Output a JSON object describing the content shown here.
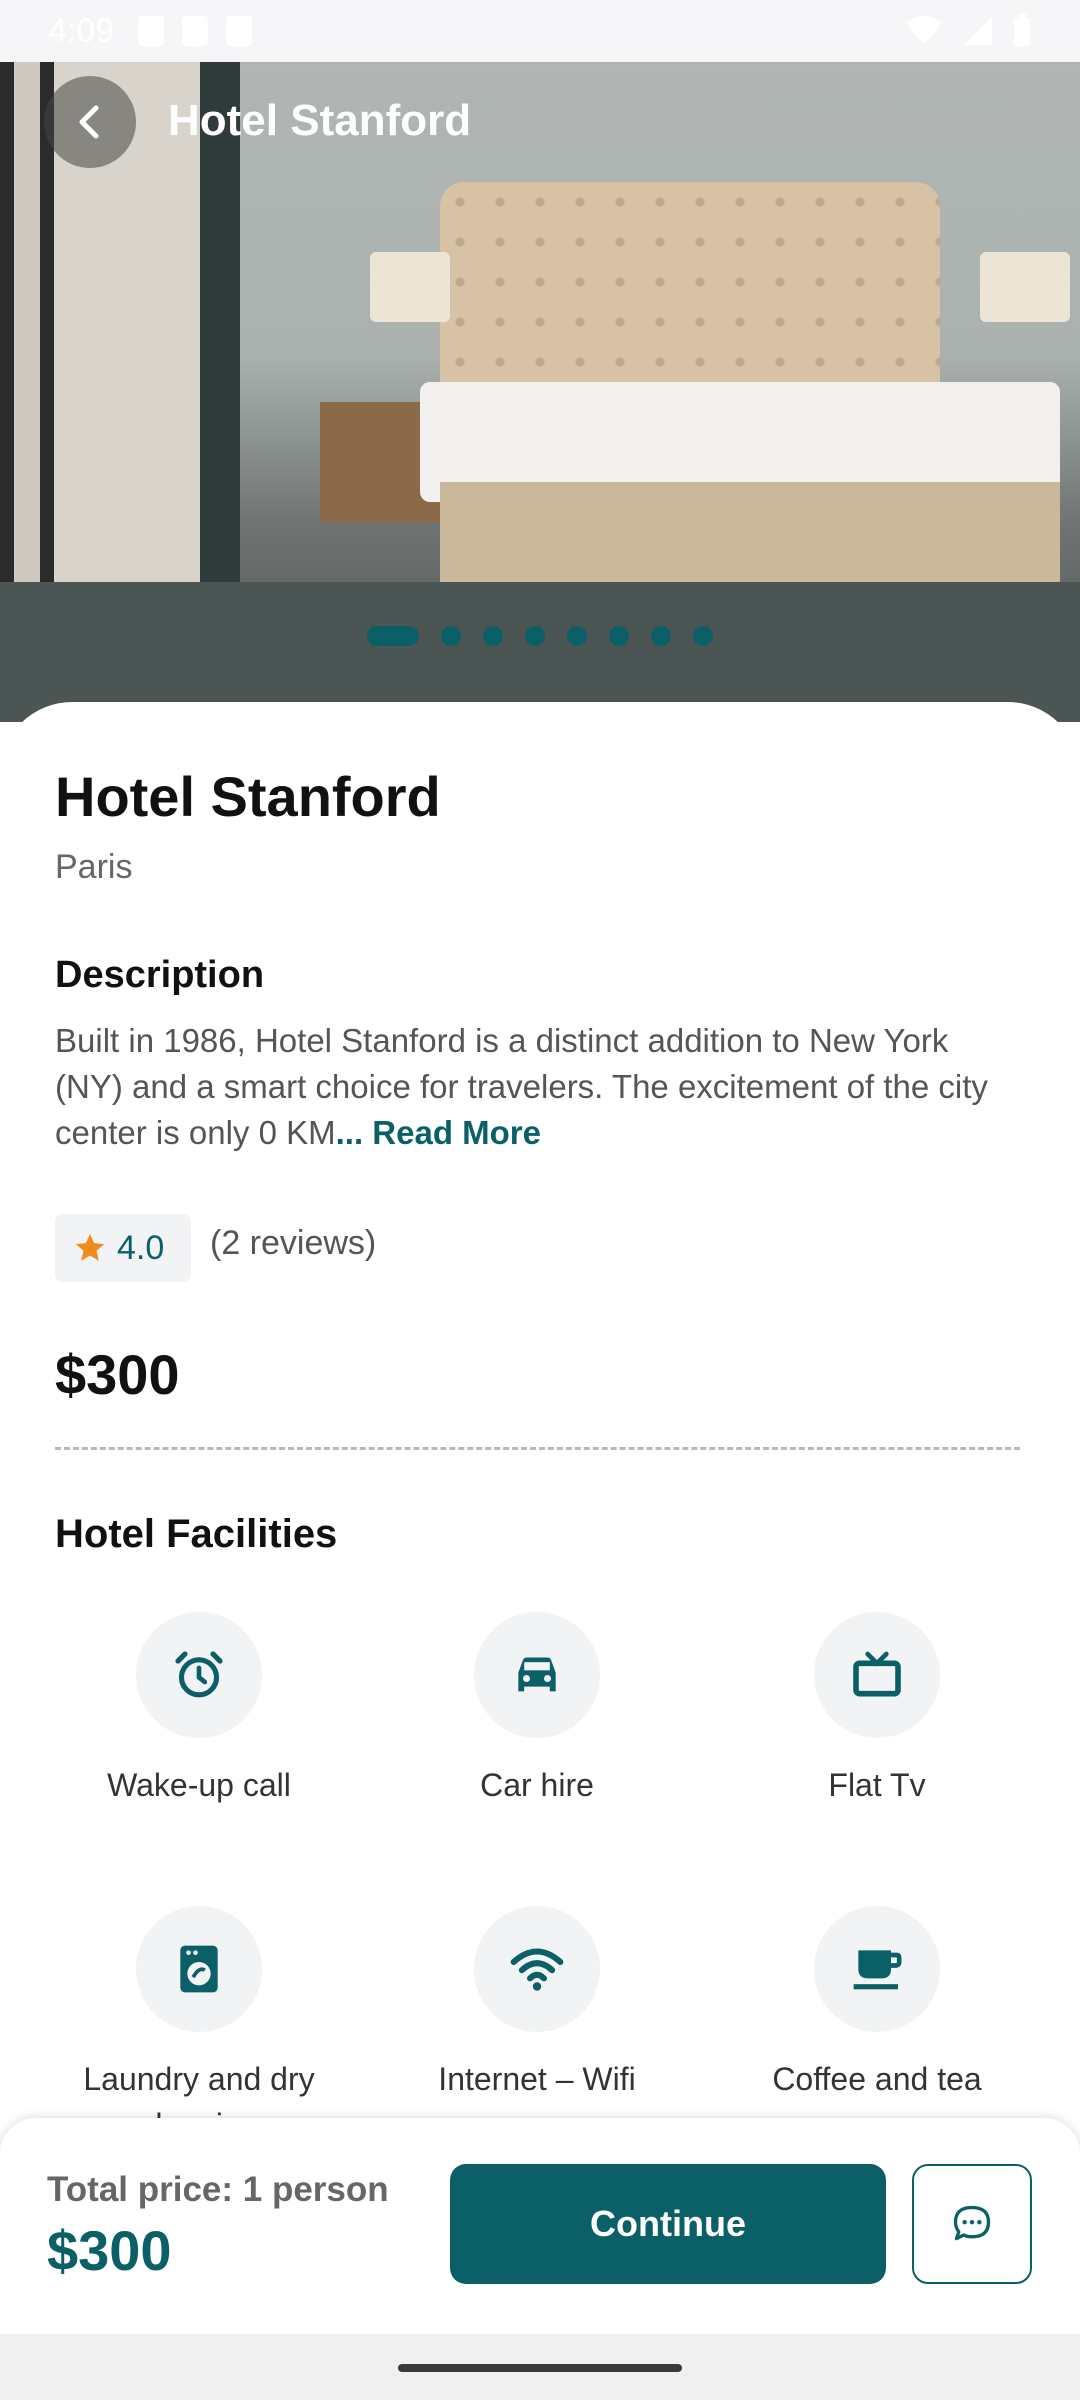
{
  "status_bar": {
    "time": "4:09"
  },
  "header": {
    "title": "Hotel Stanford"
  },
  "carousel": {
    "count": 8,
    "active_index": 0
  },
  "hotel": {
    "name": "Hotel Stanford",
    "city": "Paris",
    "description_heading": "Description",
    "description": "Built in 1986, Hotel Stanford is a distinct addition to New York (NY) and a smart choice for travelers. The excitement of the city center is only 0 KM",
    "read_more": "... Read More",
    "rating": "4.0",
    "reviews": "(2 reviews)",
    "price": "$300"
  },
  "facilities": {
    "heading": "Hotel Facilities",
    "items": [
      {
        "label": "Wake-up call",
        "icon": "alarm-clock-icon"
      },
      {
        "label": "Car hire",
        "icon": "car-icon"
      },
      {
        "label": "Flat Tv",
        "icon": "tv-icon"
      },
      {
        "label": "Laundry and dry cleaning",
        "icon": "washing-machine-icon"
      },
      {
        "label": "Internet – Wifi",
        "icon": "wifi-icon"
      },
      {
        "label": "Coffee and tea",
        "icon": "coffee-cup-icon"
      }
    ]
  },
  "bottom_bar": {
    "total_label": "Total price: 1 person",
    "total_value": "$300",
    "continue_label": "Continue"
  },
  "colors": {
    "accent": "#0b6068",
    "star": "#f08a1c"
  }
}
